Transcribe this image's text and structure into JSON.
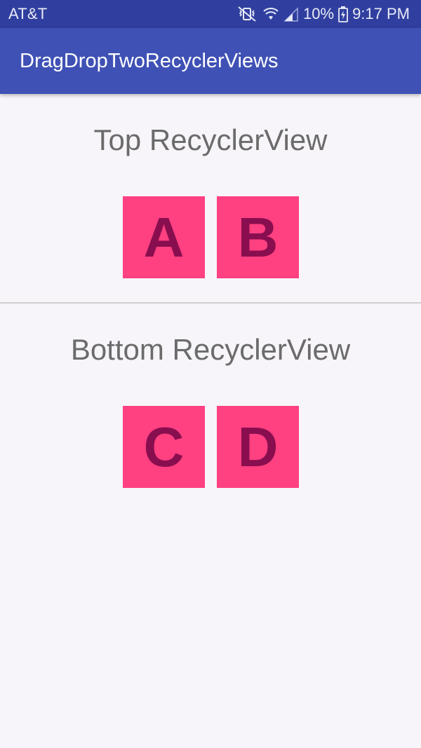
{
  "status_bar": {
    "carrier": "AT&T",
    "battery": "10%",
    "time": "9:17 PM",
    "icons": [
      "mute-vibrate-icon",
      "wifi-icon",
      "signal-icon",
      "battery-charging-icon"
    ]
  },
  "app_bar": {
    "title": "DragDropTwoRecyclerViews"
  },
  "top_list": {
    "title": "Top RecyclerView",
    "items": [
      "A",
      "B"
    ]
  },
  "bottom_list": {
    "title": "Bottom RecyclerView",
    "items": [
      "C",
      "D"
    ]
  },
  "colors": {
    "status_bar": "#303f9f",
    "app_bar": "#3f51b5",
    "tile_background": "#ff4081",
    "tile_text": "#880e4f",
    "page_background": "#f7f5fa",
    "section_title": "#6b6b6b"
  }
}
